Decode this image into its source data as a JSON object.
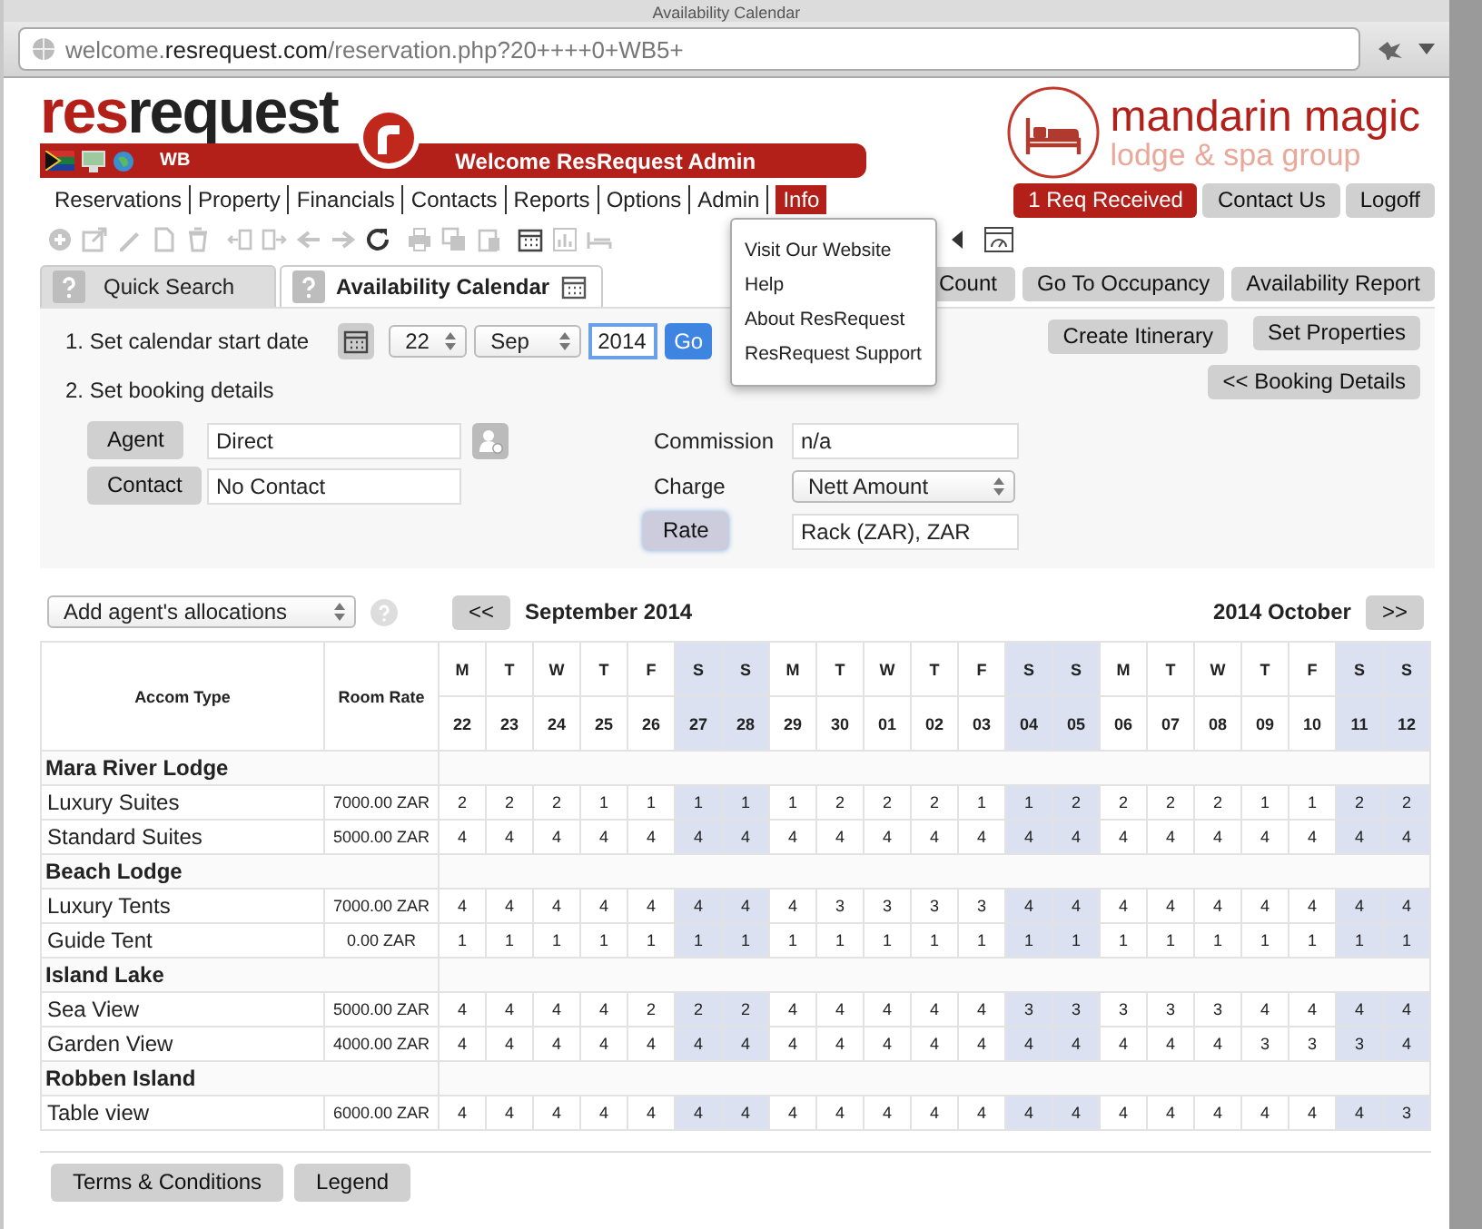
{
  "window": {
    "title": "Availability Calendar"
  },
  "address_bar": {
    "url": "welcome.**resrequest.com**/reservation.php?20++++0+WB5+"
  },
  "header": {
    "logo": "**res**request",
    "user_code": "WB",
    "welcome": "Welcome ResRequest Admin",
    "hotel_name": "mandarin magic",
    "hotel_tagline": "lodge & spa group"
  },
  "nav": [
    {
      "label": "Reservations",
      "selected": false
    },
    {
      "label": "Property",
      "selected": false
    },
    {
      "label": "Financials",
      "selected": false
    },
    {
      "label": "Contacts",
      "selected": false
    },
    {
      "label": "Reports",
      "selected": false
    },
    {
      "label": "Options",
      "selected": false
    },
    {
      "label": "Admin",
      "selected": false
    },
    {
      "label": "Info",
      "selected": true
    }
  ],
  "header_buttons": [
    {
      "label": "1 Req Received",
      "kind": "alert"
    },
    {
      "label": "Contact Us",
      "kind": "plain"
    },
    {
      "label": "Logoff",
      "kind": "plain"
    }
  ],
  "info_menu": [
    "Visit Our Website",
    "Help",
    "About ResRequest",
    "ResRequest Support"
  ],
  "tabs": [
    {
      "label": "Quick Search",
      "selected": false
    },
    {
      "label": "Availability Calendar",
      "selected": true
    }
  ],
  "tab_buttons": [
    "Count",
    "Go To Occupancy",
    "Availability Report"
  ],
  "form": {
    "step1": "1. Set calendar start date",
    "day": "22",
    "month": "Sep",
    "year": "2014",
    "go": "Go",
    "step2": "2. Set booking details",
    "agent_button": "Agent",
    "agent": "Direct",
    "contact_button": "Contact",
    "contact": "No Contact",
    "commission_label": "Commission",
    "commission": "n/a",
    "charge_label": "Charge",
    "charge": "Nett Amount",
    "rate_button": "Rate",
    "rate": "Rack (ZAR), ZAR"
  },
  "side_buttons": [
    "Create Itinerary",
    "Set Properties",
    "<< Booking Details"
  ],
  "allocations": {
    "select": "Add agent's allocations",
    "prev": "<<",
    "prev_month": "September 2014",
    "next_month": "2014 October",
    "next": ">>"
  },
  "table": {
    "columns": [
      "Accom Type",
      "Room Rate"
    ],
    "days": [
      {
        "weekday": "M",
        "date": "22",
        "weekend": false
      },
      {
        "weekday": "T",
        "date": "23",
        "weekend": false
      },
      {
        "weekday": "W",
        "date": "24",
        "weekend": false
      },
      {
        "weekday": "T",
        "date": "25",
        "weekend": false
      },
      {
        "weekday": "F",
        "date": "26",
        "weekend": false
      },
      {
        "weekday": "S",
        "date": "27",
        "weekend": true
      },
      {
        "weekday": "S",
        "date": "28",
        "weekend": true
      },
      {
        "weekday": "M",
        "date": "29",
        "weekend": false
      },
      {
        "weekday": "T",
        "date": "30",
        "weekend": false
      },
      {
        "weekday": "W",
        "date": "01",
        "weekend": false
      },
      {
        "weekday": "T",
        "date": "02",
        "weekend": false
      },
      {
        "weekday": "F",
        "date": "03",
        "weekend": false
      },
      {
        "weekday": "S",
        "date": "04",
        "weekend": true
      },
      {
        "weekday": "S",
        "date": "05",
        "weekend": true
      },
      {
        "weekday": "M",
        "date": "06",
        "weekend": false
      },
      {
        "weekday": "T",
        "date": "07",
        "weekend": false
      },
      {
        "weekday": "W",
        "date": "08",
        "weekend": false
      },
      {
        "weekday": "T",
        "date": "09",
        "weekend": false
      },
      {
        "weekday": "F",
        "date": "10",
        "weekend": false
      },
      {
        "weekday": "S",
        "date": "11",
        "weekend": true
      },
      {
        "weekday": "S",
        "date": "12",
        "weekend": true
      }
    ],
    "groups": [
      {
        "name": "Mara River Lodge",
        "rooms": [
          {
            "name": "Luxury Suites",
            "rate": "7000.00 ZAR",
            "counts": [
              "2",
              "2",
              "2",
              "1",
              "1",
              "1",
              "1",
              "1",
              "2",
              "2",
              "2",
              "1",
              "1",
              "2",
              "2",
              "2",
              "2",
              "1",
              "1",
              "2",
              "2"
            ]
          },
          {
            "name": "Standard Suites",
            "rate": "5000.00 ZAR",
            "counts": [
              "4",
              "4",
              "4",
              "4",
              "4",
              "4",
              "4",
              "4",
              "4",
              "4",
              "4",
              "4",
              "4",
              "4",
              "4",
              "4",
              "4",
              "4",
              "4",
              "4",
              "4"
            ]
          }
        ]
      },
      {
        "name": "Beach Lodge",
        "rooms": [
          {
            "name": "Luxury Tents",
            "rate": "7000.00 ZAR",
            "counts": [
              "4",
              "4",
              "4",
              "4",
              "4",
              "4",
              "4",
              "4",
              "3",
              "3",
              "3",
              "3",
              "4",
              "4",
              "4",
              "4",
              "4",
              "4",
              "4",
              "4",
              "4"
            ]
          },
          {
            "name": "Guide Tent",
            "rate": "0.00 ZAR",
            "counts": [
              "1",
              "1",
              "1",
              "1",
              "1",
              "1",
              "1",
              "1",
              "1",
              "1",
              "1",
              "1",
              "1",
              "1",
              "1",
              "1",
              "1",
              "1",
              "1",
              "1",
              "1"
            ]
          }
        ]
      },
      {
        "name": "Island Lake",
        "rooms": [
          {
            "name": "Sea View",
            "rate": "5000.00 ZAR",
            "counts": [
              "4",
              "4",
              "4",
              "4",
              "2",
              "2",
              "2",
              "4",
              "4",
              "4",
              "4",
              "4",
              "3",
              "3",
              "3",
              "3",
              "3",
              "4",
              "4",
              "4",
              "4"
            ]
          },
          {
            "name": "Garden View",
            "rate": "4000.00 ZAR",
            "counts": [
              "4",
              "4",
              "4",
              "4",
              "4",
              "4",
              "4",
              "4",
              "4",
              "4",
              "4",
              "4",
              "4",
              "4",
              "4",
              "4",
              "4",
              "3",
              "3",
              "3",
              "4"
            ]
          }
        ]
      },
      {
        "name": "Robben Island",
        "rooms": [
          {
            "name": "Table view",
            "rate": "6000.00 ZAR",
            "counts": [
              "4",
              "4",
              "4",
              "4",
              "4",
              "4",
              "4",
              "4",
              "4",
              "4",
              "4",
              "4",
              "4",
              "4",
              "4",
              "4",
              "4",
              "4",
              "4",
              "4",
              "3"
            ]
          }
        ]
      }
    ]
  },
  "footer_buttons": [
    "Terms & Conditions",
    "Legend"
  ]
}
